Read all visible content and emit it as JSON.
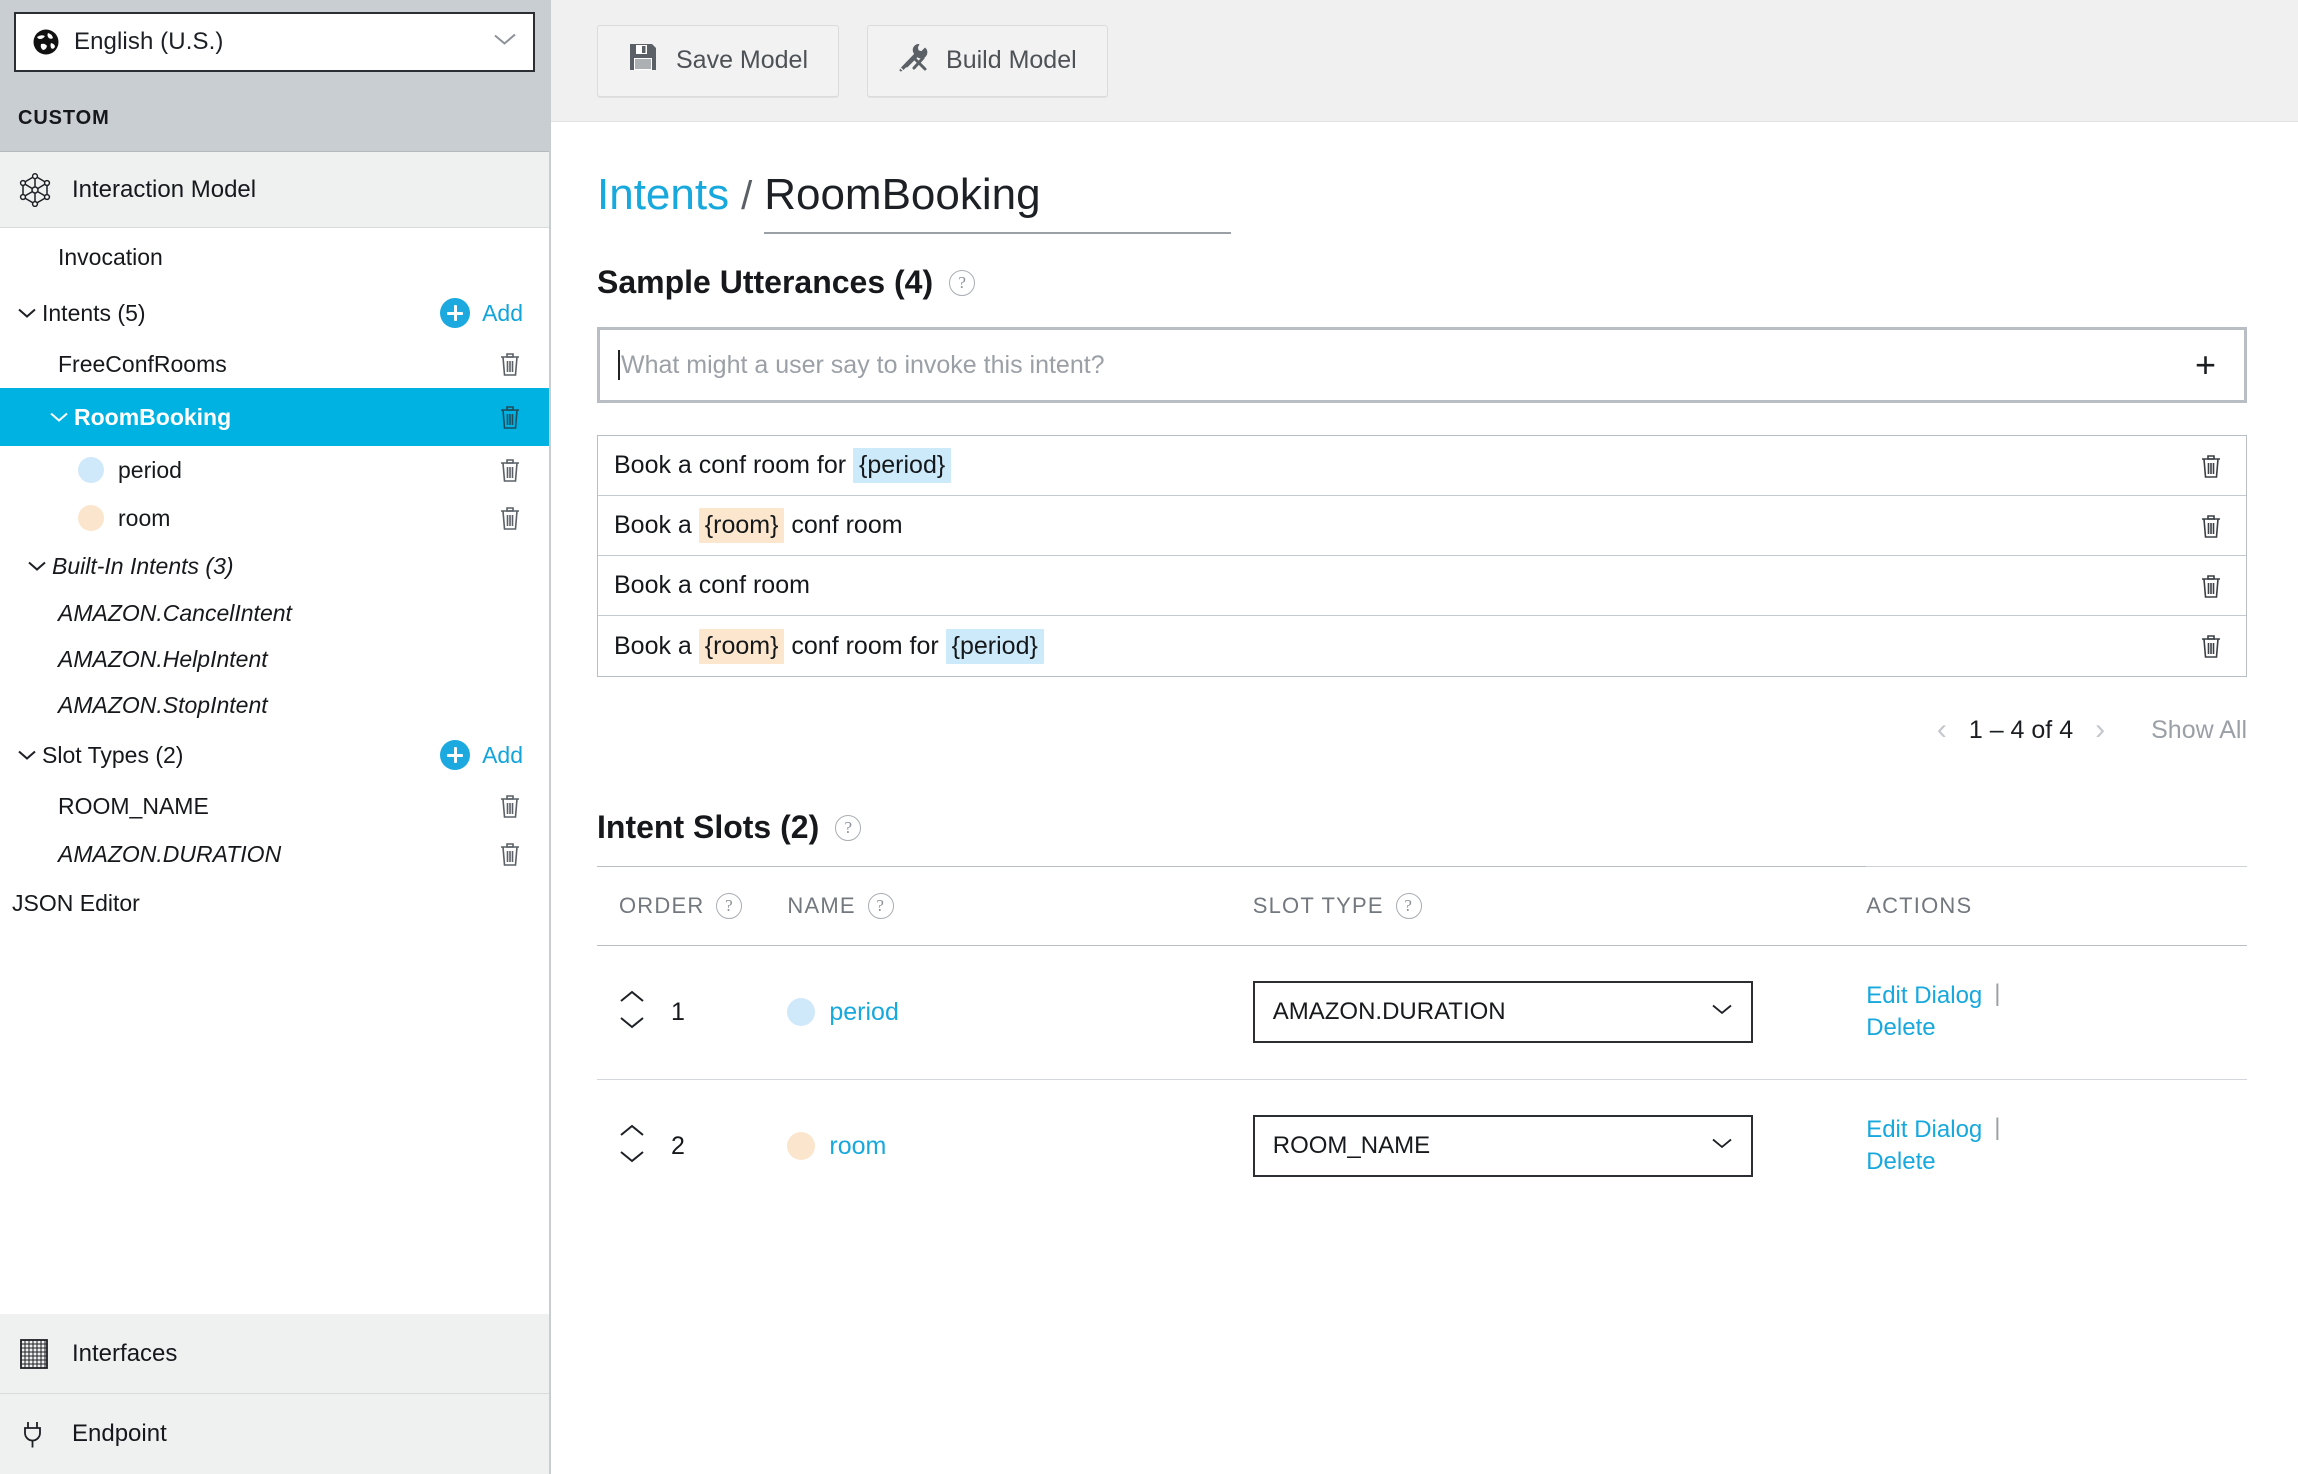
{
  "sidebar": {
    "locale": {
      "label": "English (U.S.)",
      "icon": "globe-icon",
      "chevron": "chevron-down-icon"
    },
    "section_header": "CUSTOM",
    "nav_top": {
      "label": "Interaction Model",
      "icon": "interaction-model-icon"
    },
    "tree": {
      "invocation": "Invocation",
      "intents_group": "Intents (5)",
      "add_label": "Add",
      "intents": [
        {
          "label": "FreeConfRooms",
          "selected": false
        },
        {
          "label": "RoomBooking",
          "selected": true
        }
      ],
      "room_booking_slots": [
        {
          "label": "period",
          "color": "#cfe8fa"
        },
        {
          "label": "room",
          "color": "#fbe5cd"
        }
      ],
      "builtin_group": "Built-In Intents (3)",
      "builtin_intents": [
        "AMAZON.CancelIntent",
        "AMAZON.HelpIntent",
        "AMAZON.StopIntent"
      ],
      "slot_types_group": "Slot Types (2)",
      "slot_types": [
        {
          "label": "ROOM_NAME",
          "italic": false
        },
        {
          "label": "AMAZON.DURATION",
          "italic": true
        }
      ],
      "json_editor": "JSON Editor"
    },
    "nav_bottom": [
      {
        "label": "Interfaces",
        "icon": "interfaces-grid-icon"
      },
      {
        "label": "Endpoint",
        "icon": "plug-icon"
      }
    ]
  },
  "toolbar": {
    "save_label": "Save Model",
    "build_label": "Build Model"
  },
  "breadcrumb": {
    "parent": "Intents",
    "separator": "/",
    "current": "RoomBooking"
  },
  "utterances": {
    "title": "Sample Utterances (4)",
    "input_placeholder": "What might a user say to invoke this intent?",
    "input_value": "",
    "add_symbol": "+",
    "rows": [
      {
        "parts": [
          {
            "t": "Book a conf room for ",
            "slot": null
          },
          {
            "t": "{period}",
            "slot": "period"
          }
        ]
      },
      {
        "parts": [
          {
            "t": "Book a ",
            "slot": null
          },
          {
            "t": "{room}",
            "slot": "room"
          },
          {
            "t": " conf room",
            "slot": null
          }
        ]
      },
      {
        "parts": [
          {
            "t": "Book a conf room",
            "slot": null
          }
        ]
      },
      {
        "parts": [
          {
            "t": "Book a ",
            "slot": null
          },
          {
            "t": "{room}",
            "slot": "room"
          },
          {
            "t": " conf room for ",
            "slot": null
          },
          {
            "t": "{period}",
            "slot": "period"
          }
        ]
      }
    ],
    "pagination": {
      "prev": "‹",
      "range": "1 – 4 of 4",
      "next": "›",
      "show_all": "Show All"
    }
  },
  "intent_slots": {
    "title": "Intent Slots (2)",
    "columns": [
      "ORDER",
      "NAME",
      "SLOT TYPE",
      "ACTIONS"
    ],
    "rows": [
      {
        "order": "1",
        "name": "period",
        "dot_color": "#cfe8fa",
        "slot_type": "AMAZON.DURATION",
        "edit_label": "Edit Dialog",
        "separator": "|",
        "delete_label": "Delete"
      },
      {
        "order": "2",
        "name": "room",
        "dot_color": "#fbe5cd",
        "slot_type": "ROOM_NAME",
        "edit_label": "Edit Dialog",
        "separator": "|",
        "delete_label": "Delete"
      }
    ]
  },
  "colors": {
    "accent_blue": "#17a8dd",
    "selected_row": "#00b2e2",
    "chip_period": "#cdeafb",
    "chip_room": "#fce7ce",
    "sidebar_header": "#c9ced2"
  }
}
